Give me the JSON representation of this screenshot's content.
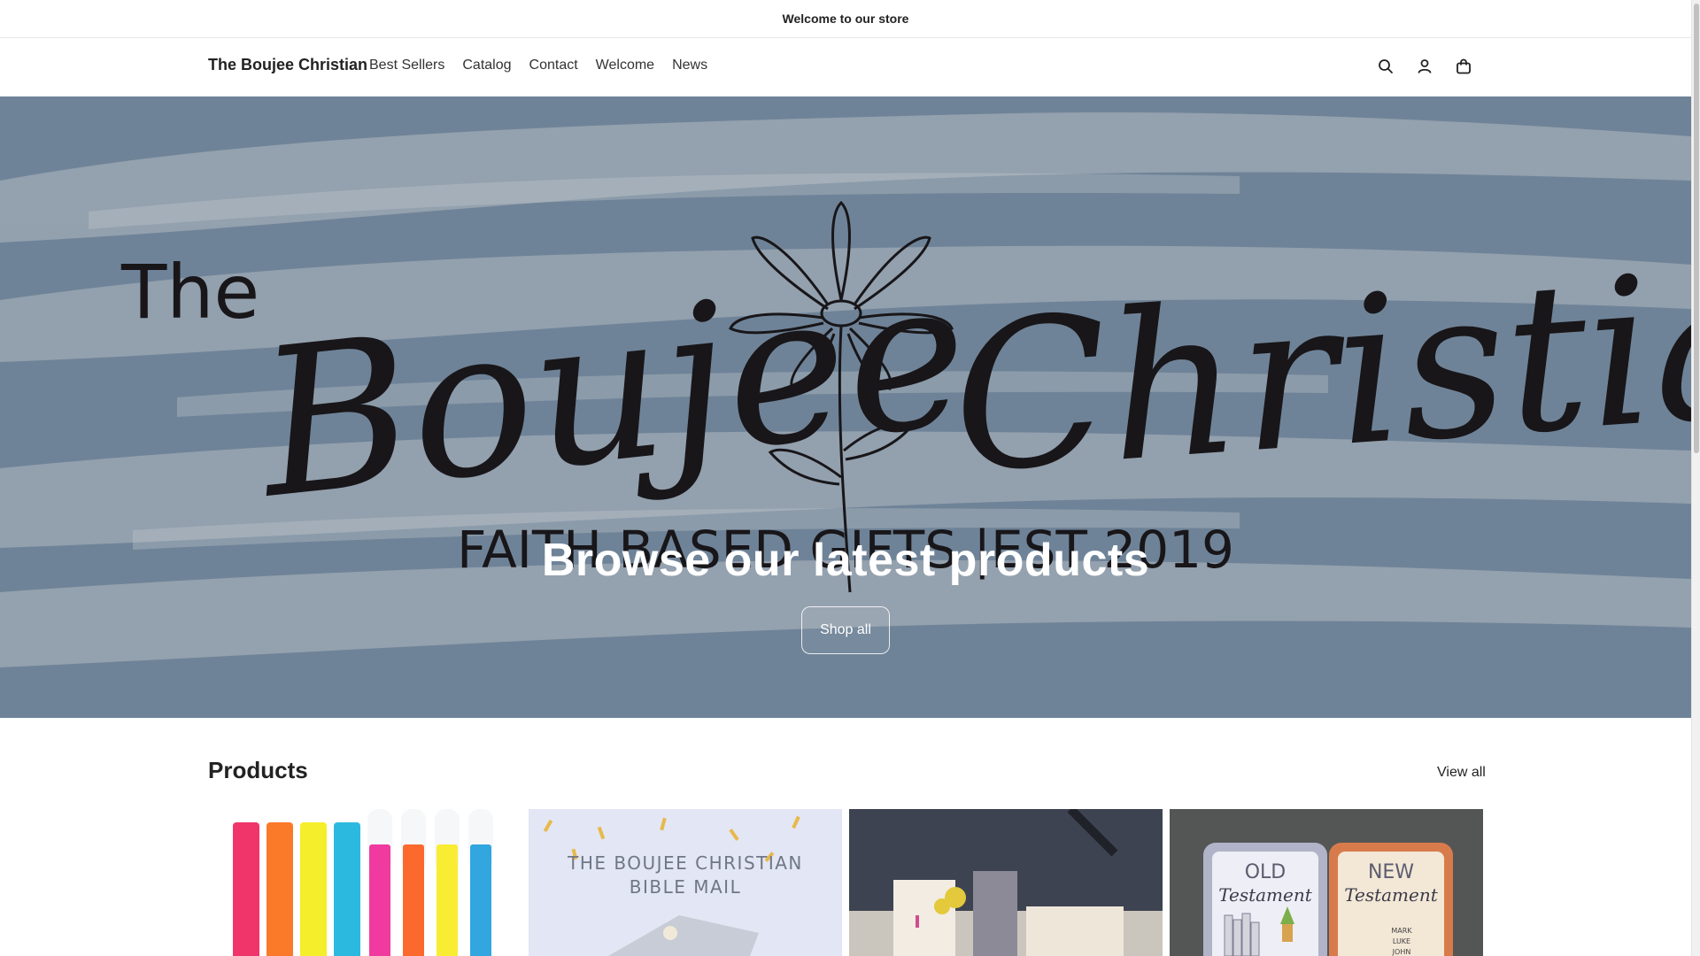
{
  "announcement": "Welcome to our store",
  "header": {
    "brand": "The Boujee Christian",
    "nav": [
      "Best Sellers",
      "Catalog",
      "Contact",
      "Welcome",
      "News"
    ],
    "icons": [
      "search-icon",
      "account-icon",
      "cart-icon"
    ]
  },
  "hero": {
    "logo_the": "The",
    "logo_boujee": "Boujee",
    "logo_christian": "Christian",
    "tagline": "FAITH BASED GIFTS |EST 2019",
    "heading": "Browse our latest products",
    "button": "Shop all"
  },
  "products": {
    "title": "Products",
    "view_all": "View all",
    "cards": [
      {
        "name": "highlighters"
      },
      {
        "name": "bible-mail",
        "line1": "THE BOUJEE CHRISTIAN",
        "line2": "BIBLE MAIL"
      },
      {
        "name": "journal-photo"
      },
      {
        "name": "testament-tins",
        "old": "OLD",
        "new": "NEW",
        "testament": "Testament",
        "books": [
          "MARK",
          "LUKE",
          "JOHN"
        ]
      }
    ]
  },
  "colors": {
    "hero_bg": "#7f96ad",
    "text": "#1a1a1a"
  }
}
